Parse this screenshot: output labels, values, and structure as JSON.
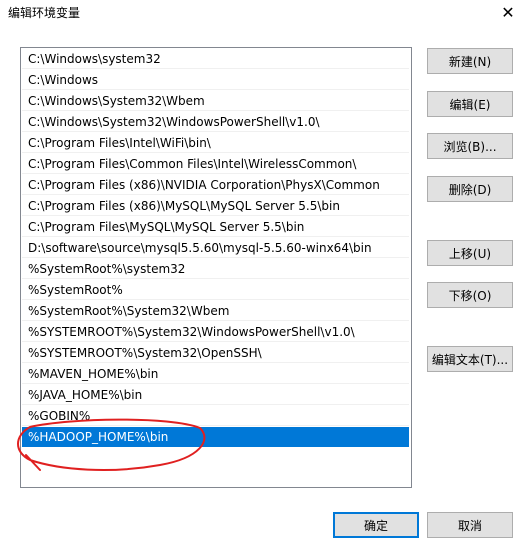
{
  "window": {
    "title": "编辑环境变量",
    "close_glyph": "✕"
  },
  "path_list": {
    "items": [
      "C:\\Windows\\system32",
      "C:\\Windows",
      "C:\\Windows\\System32\\Wbem",
      "C:\\Windows\\System32\\WindowsPowerShell\\v1.0\\",
      "C:\\Program Files\\Intel\\WiFi\\bin\\",
      "C:\\Program Files\\Common Files\\Intel\\WirelessCommon\\",
      "C:\\Program Files (x86)\\NVIDIA Corporation\\PhysX\\Common",
      "C:\\Program Files (x86)\\MySQL\\MySQL Server 5.5\\bin",
      "C:\\Program Files\\MySQL\\MySQL Server 5.5\\bin",
      "D:\\software\\source\\mysql5.5.60\\mysql-5.5.60-winx64\\bin",
      "%SystemRoot%\\system32",
      "%SystemRoot%",
      "%SystemRoot%\\System32\\Wbem",
      "%SYSTEMROOT%\\System32\\WindowsPowerShell\\v1.0\\",
      "%SYSTEMROOT%\\System32\\OpenSSH\\",
      "%MAVEN_HOME%\\bin",
      "%JAVA_HOME%\\bin",
      "%GOBIN%",
      "%HADOOP_HOME%\\bin"
    ],
    "selected_index": 18
  },
  "buttons": {
    "new": "新建(N)",
    "edit": "编辑(E)",
    "browse": "浏览(B)...",
    "delete": "删除(D)",
    "move_up": "上移(U)",
    "move_down": "下移(O)",
    "edit_text": "编辑文本(T)...",
    "ok": "确定",
    "cancel": "取消"
  },
  "colors": {
    "selection": "#0078d7",
    "annotation": "#e02020"
  }
}
